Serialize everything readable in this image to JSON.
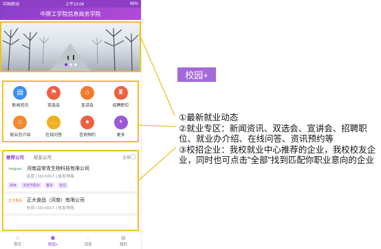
{
  "status_bar": {
    "carrier": "中国移动",
    "time": "上午10:06",
    "battery": "98%"
  },
  "app": {
    "title": "中原工学院信息商务学院"
  },
  "grid_items": [
    {
      "label": "新闻资讯",
      "icon": "news-icon",
      "color": "#3d8ef0",
      "glyph": "▤"
    },
    {
      "label": "双选会",
      "icon": "flag-icon",
      "color": "#f06040",
      "glyph": "⚑"
    },
    {
      "label": "宣讲会",
      "icon": "building-icon",
      "color": "#f07a30",
      "glyph": "⌂"
    },
    {
      "label": "招聘职位",
      "icon": "tie-icon",
      "color": "#f06040",
      "glyph": "♜"
    },
    {
      "label": "就业办介绍",
      "icon": "office-icon",
      "color": "#f08a30",
      "glyph": "⌂"
    },
    {
      "label": "在线问答",
      "icon": "chat-icon",
      "color": "#f0b020",
      "glyph": "…"
    },
    {
      "label": "咨询预约",
      "icon": "message-icon",
      "color": "#f06040",
      "glyph": "●"
    },
    {
      "label": "更多",
      "icon": "plus-icon",
      "color": "#9b59d6",
      "glyph": "+"
    }
  ],
  "company_tabs": {
    "recommended": "推荐公司",
    "alumni": "校友公司",
    "all": "全部"
  },
  "companies": [
    {
      "name": "河南益常青生物科技有限公司",
      "meta": "民营 | 150-500人 | 批发/零售",
      "logo_text": "longjuan",
      "tags": [
        "双休",
        "法定节假日",
        "餐补",
        "包住"
      ]
    },
    {
      "name": "正大食品（河南）有限公司",
      "meta": "外资 | 150-500人 | 批发/零售",
      "logo_text": "正大食品",
      "tags": []
    }
  ],
  "bottom_nav": [
    {
      "label": "首页",
      "icon": "home-icon",
      "glyph": "⌂"
    },
    {
      "label": "校园+",
      "icon": "eye-icon",
      "glyph": "◉"
    },
    {
      "label": "消息",
      "icon": "message-icon",
      "glyph": "◌"
    },
    {
      "label": "我的",
      "icon": "user-icon",
      "glyph": "◍"
    }
  ],
  "callout": {
    "label": "校园+"
  },
  "annotation_lines": [
    "①最新就业动态",
    "②就业专区：新闻资讯、双选会、宣讲会、招聘职位、就业办介绍、在线问答、资讯预约等",
    "③校招企业：我校就业中心推荐的企业，我校校友企业，同时也可点击\"全部\"找到匹配你职业意向的企业"
  ],
  "colors": {
    "brand": "#8a3fcb",
    "highlight": "#f0c020",
    "callout": "#a36ad9"
  }
}
